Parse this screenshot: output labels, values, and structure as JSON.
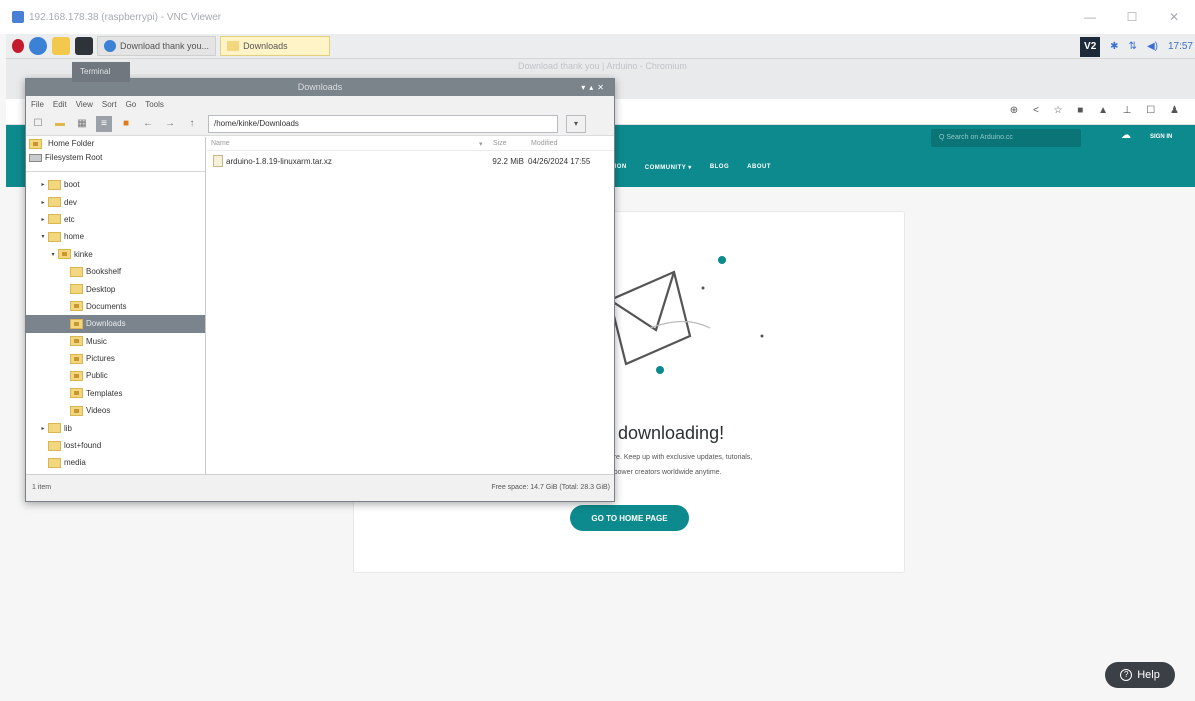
{
  "vnc": {
    "title": "192.168.178.38 (raspberrypi) - VNC Viewer",
    "minimize": "—",
    "maximize": "☐",
    "close": "✕"
  },
  "taskbar": {
    "chromium_task": "Download thank you...",
    "files_task": "Downloads",
    "clock": "17:57"
  },
  "chrome": {
    "window_title": "Download thank you | Arduino - Chromium"
  },
  "site": {
    "search_placeholder": "Q  Search on Arduino.cc",
    "signin": "SIGN IN",
    "nav": [
      "ATION",
      "COMMUNITY ▾",
      "BLOG",
      "ABOUT"
    ],
    "headline": "r downloading!",
    "sub1": "uture. Keep up with exclusive updates, tutorials,",
    "sub2": "empower creators worldwide anytime.",
    "home_button": "GO TO HOME PAGE",
    "help": "Help"
  },
  "fm": {
    "title": "Downloads",
    "tooltip": "Terminal",
    "menu": [
      "File",
      "Edit",
      "View",
      "Sort",
      "Go",
      "Tools"
    ],
    "path": "/home/kinke/Downloads",
    "places": [
      "Home Folder",
      "Filesystem Root"
    ],
    "tree": [
      {
        "label": "boot",
        "arrow": "▸"
      },
      {
        "label": "dev",
        "arrow": "▸"
      },
      {
        "label": "etc",
        "arrow": "▸"
      },
      {
        "label": "home",
        "arrow": "▾"
      },
      {
        "label": "kinke",
        "arrow": "▾"
      },
      {
        "label": "Bookshelf",
        "arrow": ""
      },
      {
        "label": "Desktop",
        "arrow": ""
      },
      {
        "label": "Documents",
        "arrow": ""
      },
      {
        "label": "Downloads",
        "arrow": ""
      },
      {
        "label": "Music",
        "arrow": ""
      },
      {
        "label": "Pictures",
        "arrow": ""
      },
      {
        "label": "Public",
        "arrow": ""
      },
      {
        "label": "Templates",
        "arrow": ""
      },
      {
        "label": "Videos",
        "arrow": ""
      },
      {
        "label": "lib",
        "arrow": "▸"
      },
      {
        "label": "lost+found",
        "arrow": ""
      },
      {
        "label": "media",
        "arrow": ""
      }
    ],
    "columns": {
      "name": "Name",
      "size": "Size",
      "modified": "Modified"
    },
    "files": [
      {
        "name": "arduino-1.8.19-linuxarm.tar.xz",
        "size": "92.2 MiB",
        "modified": "04/26/2024 17:55"
      }
    ],
    "status_items": "1 item",
    "status_space": "Free space: 14.7 GiB (Total: 28.3 GiB)"
  },
  "colors": {
    "arduino_teal": "#0d8a8d",
    "selection": "#7b848c"
  }
}
